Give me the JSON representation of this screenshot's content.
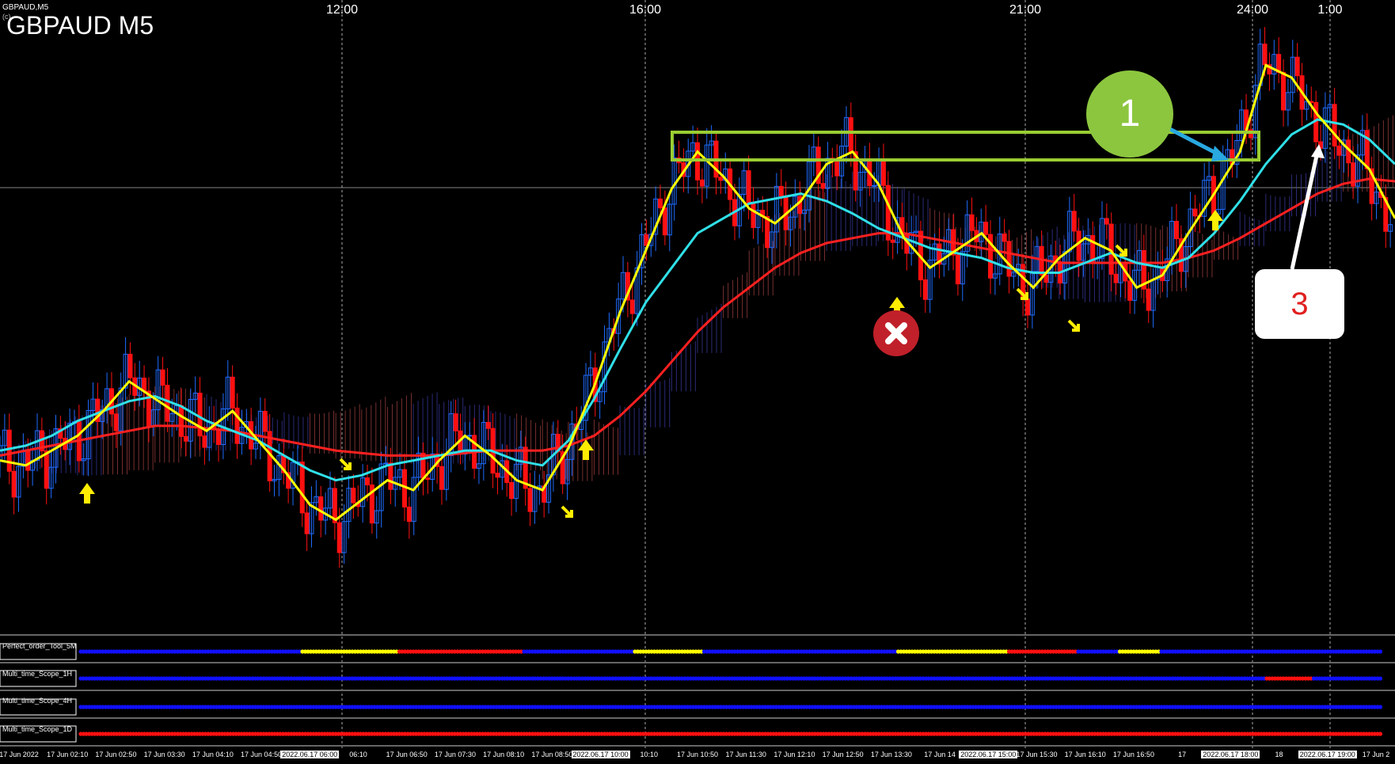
{
  "window": {
    "symbol_small": "GBPAUD,M5",
    "copyright": "(c) ",
    "symbol_large": "GBPAUD M5"
  },
  "top_time_labels": [
    "12:00",
    "16:00",
    "21:00",
    "24:00",
    "1:00"
  ],
  "indicator_panels": [
    {
      "label": "Perfect_order_Tool_5M"
    },
    {
      "label": "Multi_time_Scope_1H"
    },
    {
      "label": "Multi_time_Scope_4H"
    },
    {
      "label": "Multi_time_Scope_1D"
    }
  ],
  "x_axis_ticks": [
    "17 Jun 2022",
    "17 Jun 02:10",
    "17 Jun 02:50",
    "17 Jun 03:30",
    "17 Jun 04:10",
    "17 Jun 04:50",
    "2022.06.17 06:00",
    "06:10",
    "17 Jun 06:50",
    "17 Jun 07:30",
    "17 Jun 08:10",
    "17 Jun 08:50",
    "2022.06.17 10:00",
    "10:10",
    "17 Jun 10:50",
    "17 Jun 11:30",
    "17 Jun 12:10",
    "17 Jun 12:50",
    "17 Jun 13:30",
    "17 Jun 14",
    "2022.06.17 15:00",
    "17 Jun 15:30",
    "17 Jun 16:10",
    "17 Jun 16:50",
    "17",
    "2022.06.17 18:00",
    "18",
    "2022.06.17 19:00",
    "17 Jun 2"
  ],
  "annotations": {
    "callout_1": "1",
    "callout_3": "3"
  },
  "colors": {
    "background": "#000000",
    "bull_candle": "#1e6cff",
    "bear_candle": "#ff1010",
    "ma_fast": "#ffff00",
    "ma_mid": "#30e0e8",
    "ma_slow": "#ff2020",
    "box": "#9acd32",
    "dot_blue": "#1010ff",
    "dot_red": "#ff1010",
    "dot_yellow": "#ffff00"
  },
  "chart_data": {
    "type": "candlestick",
    "title": "GBPAUD M5",
    "series": [
      {
        "values": [
          1.762,
          1.7618,
          1.7624,
          1.763,
          1.764,
          1.7652,
          1.7645,
          1.7638,
          1.7632,
          1.764,
          1.7628,
          1.7616,
          1.7602,
          1.7596,
          1.7604,
          1.7612,
          1.7608,
          1.762,
          1.763,
          1.7622,
          1.7612,
          1.7608,
          1.7625,
          1.765,
          1.768,
          1.7705,
          1.773,
          1.7745,
          1.7735,
          1.7722,
          1.7716,
          1.7725,
          1.774,
          1.7745,
          1.7732,
          1.771,
          1.7698,
          1.7705,
          1.7712,
          1.77,
          1.769,
          1.7702,
          1.771,
          1.7705,
          1.769,
          1.7695,
          1.7712,
          1.7728,
          1.7745,
          1.778,
          1.7775,
          1.776,
          1.7748,
          1.7738,
          1.7718
        ]
      },
      {
        "values": [
          1.7624,
          1.7626,
          1.763,
          1.7636,
          1.764,
          1.7644,
          1.7646,
          1.7642,
          1.7636,
          1.7632,
          1.7628,
          1.7622,
          1.7616,
          1.7612,
          1.7614,
          1.7618,
          1.762,
          1.7622,
          1.7624,
          1.7624,
          1.762,
          1.7618,
          1.7628,
          1.7645,
          1.7665,
          1.7684,
          1.7698,
          1.7712,
          1.7718,
          1.7724,
          1.7726,
          1.7728,
          1.7725,
          1.772,
          1.7714,
          1.771,
          1.7706,
          1.7704,
          1.7702,
          1.7698,
          1.7696,
          1.7696,
          1.77,
          1.7704,
          1.77,
          1.7698,
          1.7702,
          1.7712,
          1.7725,
          1.774,
          1.7752,
          1.7758,
          1.7756,
          1.775,
          1.774
        ]
      },
      {
        "values": [
          1.7622,
          1.7624,
          1.7626,
          1.7628,
          1.763,
          1.7632,
          1.7634,
          1.7634,
          1.7633,
          1.7632,
          1.763,
          1.7628,
          1.7626,
          1.7624,
          1.7623,
          1.7622,
          1.7622,
          1.7622,
          1.7623,
          1.7624,
          1.7624,
          1.7624,
          1.7626,
          1.763,
          1.7638,
          1.7648,
          1.766,
          1.7672,
          1.7682,
          1.769,
          1.7698,
          1.7704,
          1.7708,
          1.771,
          1.7712,
          1.7712,
          1.771,
          1.7708,
          1.7706,
          1.7704,
          1.7702,
          1.77,
          1.77,
          1.77,
          1.77,
          1.77,
          1.7702,
          1.7705,
          1.771,
          1.7716,
          1.7722,
          1.7728,
          1.7732,
          1.7734,
          1.7733
        ]
      }
    ],
    "ylim": [
      1.755,
      1.78
    ]
  }
}
